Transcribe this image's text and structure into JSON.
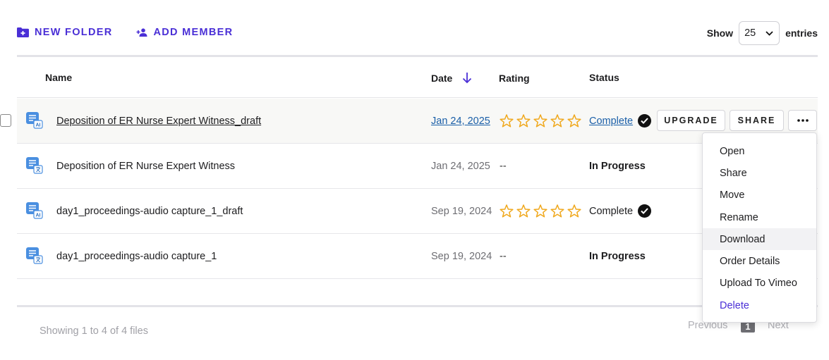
{
  "toolbar": {
    "new_folder": "NEW FOLDER",
    "add_member": "ADD MEMBER"
  },
  "entries": {
    "show": "Show",
    "value": "25",
    "suffix": "entries"
  },
  "table": {
    "headers": {
      "name": "Name",
      "date": "Date",
      "rating": "Rating",
      "status": "Status"
    },
    "rows": [
      {
        "name": "Deposition of ER Nurse Expert Witness_draft",
        "date": "Jan 24, 2025",
        "rating": "",
        "status": "Complete"
      },
      {
        "name": "Deposition of ER Nurse Expert Witness",
        "date": "Jan 24, 2025",
        "rating": "--",
        "status": "In Progress"
      },
      {
        "name": "day1_proceedings-audio capture_1_draft",
        "date": "Sep 19, 2024",
        "rating": "",
        "status": "Complete"
      },
      {
        "name": "day1_proceedings-audio capture_1",
        "date": "Sep 19, 2024",
        "rating": "--",
        "status": "In Progress"
      }
    ]
  },
  "actions": {
    "upgrade": "UPGRADE",
    "share": "SHARE"
  },
  "menu": [
    "Open",
    "Share",
    "Move",
    "Rename",
    "Download",
    "Order Details",
    "Upload To Vimeo",
    "Delete"
  ],
  "footer": {
    "showing": "Showing 1 to 4 of 4 files",
    "previous": "Previous",
    "page": "1",
    "next": "Next"
  },
  "colors": {
    "accent": "#4a2fd6",
    "link": "#1a5fa8",
    "star": "#f0a81c"
  },
  "icons": [
    "folder-plus-icon",
    "person-add-icon",
    "chevron-down-icon",
    "arrow-down-icon",
    "ai-transcript-icon",
    "translate-transcript-icon",
    "star-outline-icon",
    "check-circle-icon",
    "more-horizontal-icon"
  ]
}
